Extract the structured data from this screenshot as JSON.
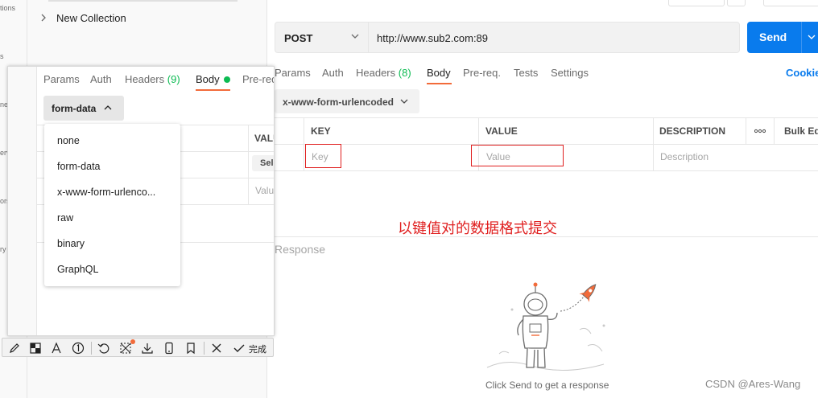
{
  "left_strip": {
    "fragments": [
      "tions",
      "s",
      "ne",
      "erv",
      "ors",
      "ry"
    ]
  },
  "sidebar": {
    "collection_label": "New Collection"
  },
  "request": {
    "method": "POST",
    "url": "http://www.sub2.com:89",
    "send_label": "Send"
  },
  "main_tabs": {
    "params": "Params",
    "auth": "Auth",
    "headers": "Headers",
    "headers_count": "(8)",
    "body": "Body",
    "prereq": "Pre-req.",
    "tests": "Tests",
    "settings": "Settings",
    "cookies": "Cookie"
  },
  "body_encoding": "x-www-form-urlencoded",
  "kv_table": {
    "columns": [
      "KEY",
      "VALUE",
      "DESCRIPTION"
    ],
    "bulk_edit": "Bulk Ed",
    "placeholders": {
      "key": "Key",
      "value": "Value",
      "description": "Description"
    }
  },
  "annotation": "以键值对的数据格式提交",
  "response": {
    "label": "Response",
    "empty_message": "Click Send to get a response"
  },
  "watermark": "CSDN @Ares-Wang",
  "snippet": {
    "tabs": {
      "params": "Params",
      "auth": "Auth",
      "headers": "Headers",
      "headers_count": "(9)",
      "body": "Body",
      "prereq": "Pre-req"
    },
    "body_type": "form-data",
    "value_header": "VALU",
    "select_label": "Sele",
    "value_placeholder": "Valu",
    "menu_items": [
      "none",
      "form-data",
      "x-www-form-urlenco...",
      "raw",
      "binary",
      "GraphQL"
    ]
  },
  "toolbar": {
    "done_label": "完成",
    "icons": [
      "pencil-icon",
      "mosaic-icon",
      "text-icon",
      "number-icon",
      "undo-icon",
      "crop-icon",
      "download-icon",
      "phone-icon",
      "bookmark-icon",
      "close-icon",
      "check-icon"
    ]
  },
  "colors": {
    "accent_orange": "#f26b3a",
    "send_blue": "#097bed",
    "count_green": "#0cbb52",
    "annotation_red": "#e02020"
  }
}
